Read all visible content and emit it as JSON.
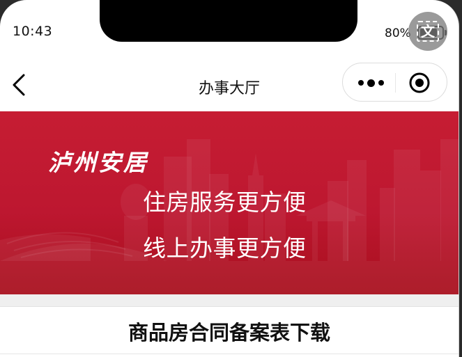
{
  "status_bar": {
    "time": "10:43",
    "battery_percent": "80%",
    "battery_level": 0.8,
    "translate_icon": "translate-icon",
    "translate_glyph": "文"
  },
  "nav": {
    "title": "办事大厅",
    "back_icon": "chevron-left-icon",
    "more_icon": "more-dots-icon",
    "close_icon": "target-close-icon"
  },
  "banner": {
    "brand": "泸州安居",
    "slogan_line1": "住房服务更方便",
    "slogan_line2": "线上办事更方便",
    "colors": {
      "top": "#c61d33",
      "bottom": "#a80f1d"
    }
  },
  "section": {
    "title": "商品房合同备案表下载"
  }
}
